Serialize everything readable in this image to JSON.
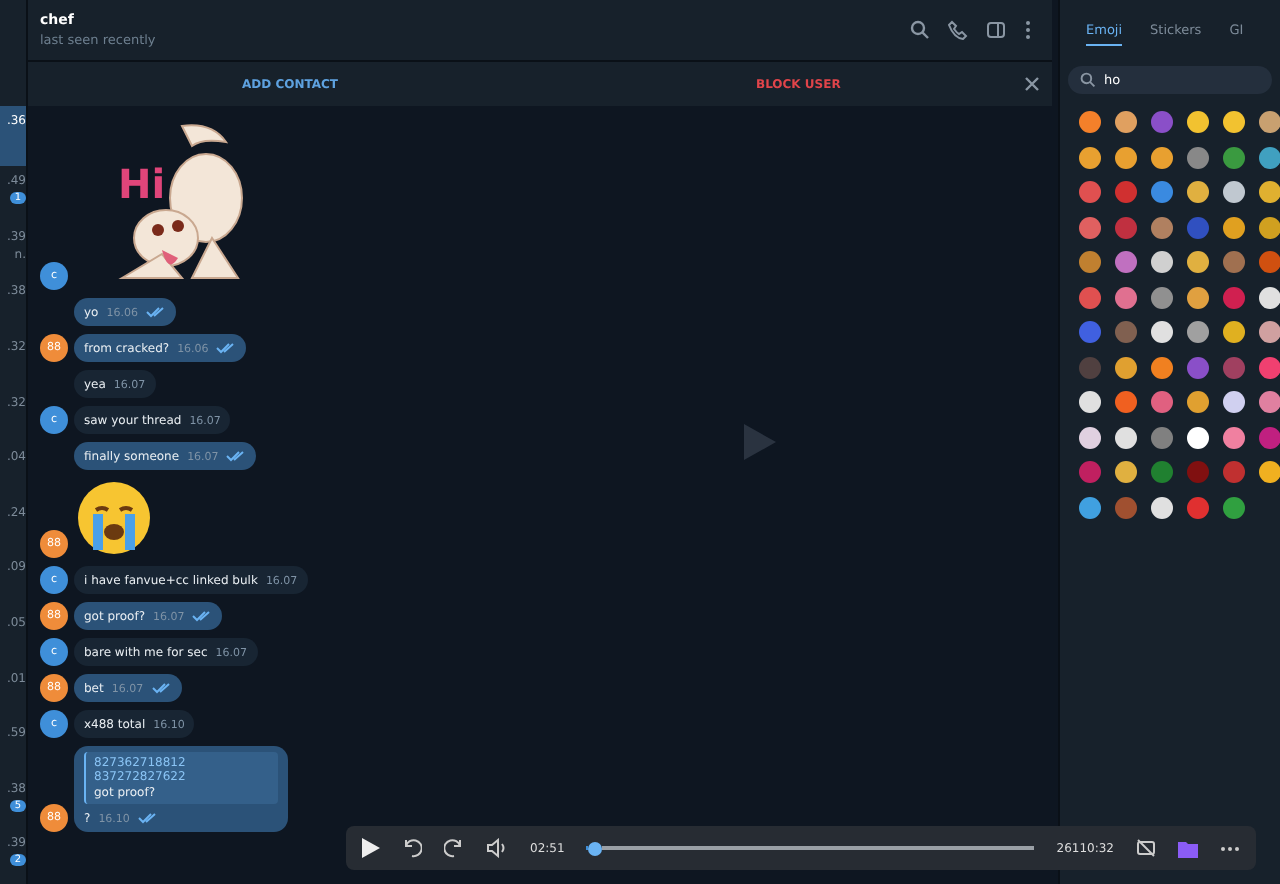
{
  "sidebar": {
    "items": [
      {
        "time": ".36",
        "selected": true
      },
      {
        "time": ".49",
        "badge": "1",
        "selected": false
      },
      {
        "time": ".39",
        "preview": "n.",
        "selected": false
      },
      {
        "time": ".38",
        "selected": false
      },
      {
        "time": ".32",
        "selected": false
      },
      {
        "time": ".32",
        "selected": false
      },
      {
        "time": ".04",
        "selected": false
      },
      {
        "time": ".24",
        "selected": false
      },
      {
        "time": ".09",
        "selected": false
      },
      {
        "time": ".05",
        "selected": false
      },
      {
        "time": ".01",
        "selected": false
      },
      {
        "time": ".59",
        "selected": false
      },
      {
        "time": ".38",
        "badge": "5",
        "selected": false
      },
      {
        "time": ".39",
        "badge": "2",
        "selected": false
      }
    ]
  },
  "header": {
    "name": "chef",
    "status": "last seen recently"
  },
  "action_bar": {
    "add_contact": "ADD CONTACT",
    "block_user": "BLOCK USER"
  },
  "messages": [
    {
      "kind": "sticker",
      "avatar": "c",
      "sticker_text": "Hi"
    },
    {
      "kind": "text",
      "text": "yo",
      "time": "16.06",
      "outgoing": true,
      "read": true
    },
    {
      "kind": "text",
      "text": "from cracked?",
      "time": "16.06",
      "outgoing": true,
      "read": true,
      "avatar": "88"
    },
    {
      "kind": "text",
      "text": "yea",
      "time": "16.07",
      "outgoing": false
    },
    {
      "kind": "text",
      "text": "saw your thread",
      "time": "16.07",
      "outgoing": false,
      "avatar": "c"
    },
    {
      "kind": "text",
      "text": "finally someone",
      "time": "16.07",
      "outgoing": true,
      "read": true
    },
    {
      "kind": "emoji",
      "avatar": "88"
    },
    {
      "kind": "text",
      "text": "i have fanvue+cc linked bulk",
      "time": "16.07",
      "outgoing": false,
      "avatar": "c"
    },
    {
      "kind": "text",
      "text": "got proof?",
      "time": "16.07",
      "outgoing": true,
      "read": true,
      "avatar": "88"
    },
    {
      "kind": "text",
      "text": "bare with me for sec",
      "time": "16.07",
      "outgoing": false,
      "avatar": "c"
    },
    {
      "kind": "text",
      "text": "bet",
      "time": "16.07",
      "outgoing": true,
      "read": true,
      "avatar": "88"
    },
    {
      "kind": "text",
      "text": "x488 total",
      "time": "16.10",
      "outgoing": false,
      "avatar": "c"
    },
    {
      "kind": "reply",
      "quote_title": "827362718812 837272827622",
      "quote_text": "got proof?",
      "text": "?",
      "time": "16.10",
      "outgoing": true,
      "read": true,
      "avatar": "88"
    }
  ],
  "emoji_panel": {
    "tabs": [
      {
        "label": "Emoji",
        "selected": true
      },
      {
        "label": "Stickers",
        "selected": false
      },
      {
        "label": "GI",
        "selected": false
      }
    ],
    "search": {
      "value": "ho"
    }
  },
  "player": {
    "elapsed": "02:51",
    "total": "26110:32",
    "level": 0.005
  }
}
